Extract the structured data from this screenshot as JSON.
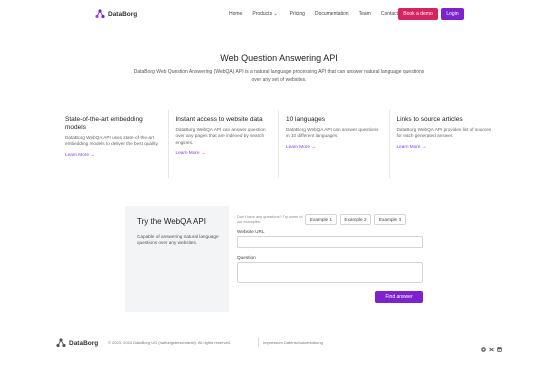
{
  "brand": {
    "name": "DataBorg",
    "accent": "#7e22ce",
    "demo_color": "#d6245f"
  },
  "nav": {
    "items": [
      "Home",
      "Products ⌄",
      "Pricing",
      "Documentation",
      "Team",
      "Contact"
    ],
    "demo_label": "Book a demo",
    "login_label": "Login"
  },
  "hero": {
    "title": "Web Question Answering API",
    "description": "DataBorg Web Question Answering (WebQA) API is a natural language processing API that can answer natural language questions over any set of websites."
  },
  "features": [
    {
      "title": "State-of-the-art embedding models",
      "text": "DataBorg WebQA API uses state-of-the-art embedding models to deliver the best quality.",
      "link": "Learn More →"
    },
    {
      "title": "Instant access to website data",
      "text": "DataBorg WebQA API can answer question over any pages that are indexed by search engines.",
      "link": "Learn More →"
    },
    {
      "title": "10 languages",
      "text": "DataBorg WebQA API can answer questions in 10 different languages.",
      "link": "Learn More →"
    },
    {
      "title": "Links to source articles",
      "text": "DataBorg WebQA API provides list of sources for each generated answer.",
      "link": "Learn More →"
    }
  ],
  "try": {
    "title": "Try the WebQA API",
    "description": "Capable of answering natural language questions over any websites.",
    "hint": "Don't have any questions? Try some of our examples:",
    "examples": [
      "Example 1",
      "Example 2",
      "Example 3"
    ],
    "url_label": "Website URL",
    "url_value": "",
    "question_label": "Question",
    "question_value": "",
    "submit_label": "Find answer"
  },
  "footer": {
    "copyright": "© 2023, 2024 DataBorg UG (haftungsbeschränkt). All rights reserved.",
    "legal": "Impressum  Datenschutzerklärung",
    "social_icons": [
      "github-icon",
      "twitter-icon",
      "linkedin-icon"
    ]
  }
}
